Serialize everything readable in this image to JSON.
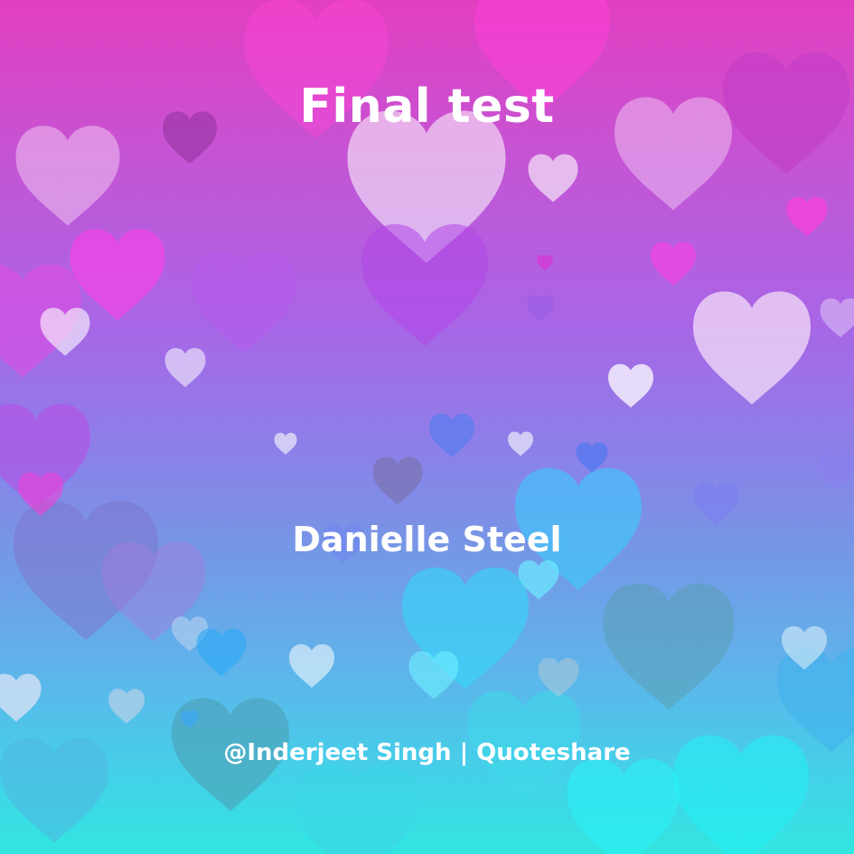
{
  "quote": {
    "title": "Final test",
    "author": "Danielle Steel",
    "credit": "@Inderjeet Singh | Quoteshare"
  },
  "colors": {
    "text": "#ffffff",
    "gradient_top": "#e23fc0",
    "gradient_middle": "#8d7fe8",
    "gradient_bottom": "#31e6e0"
  }
}
